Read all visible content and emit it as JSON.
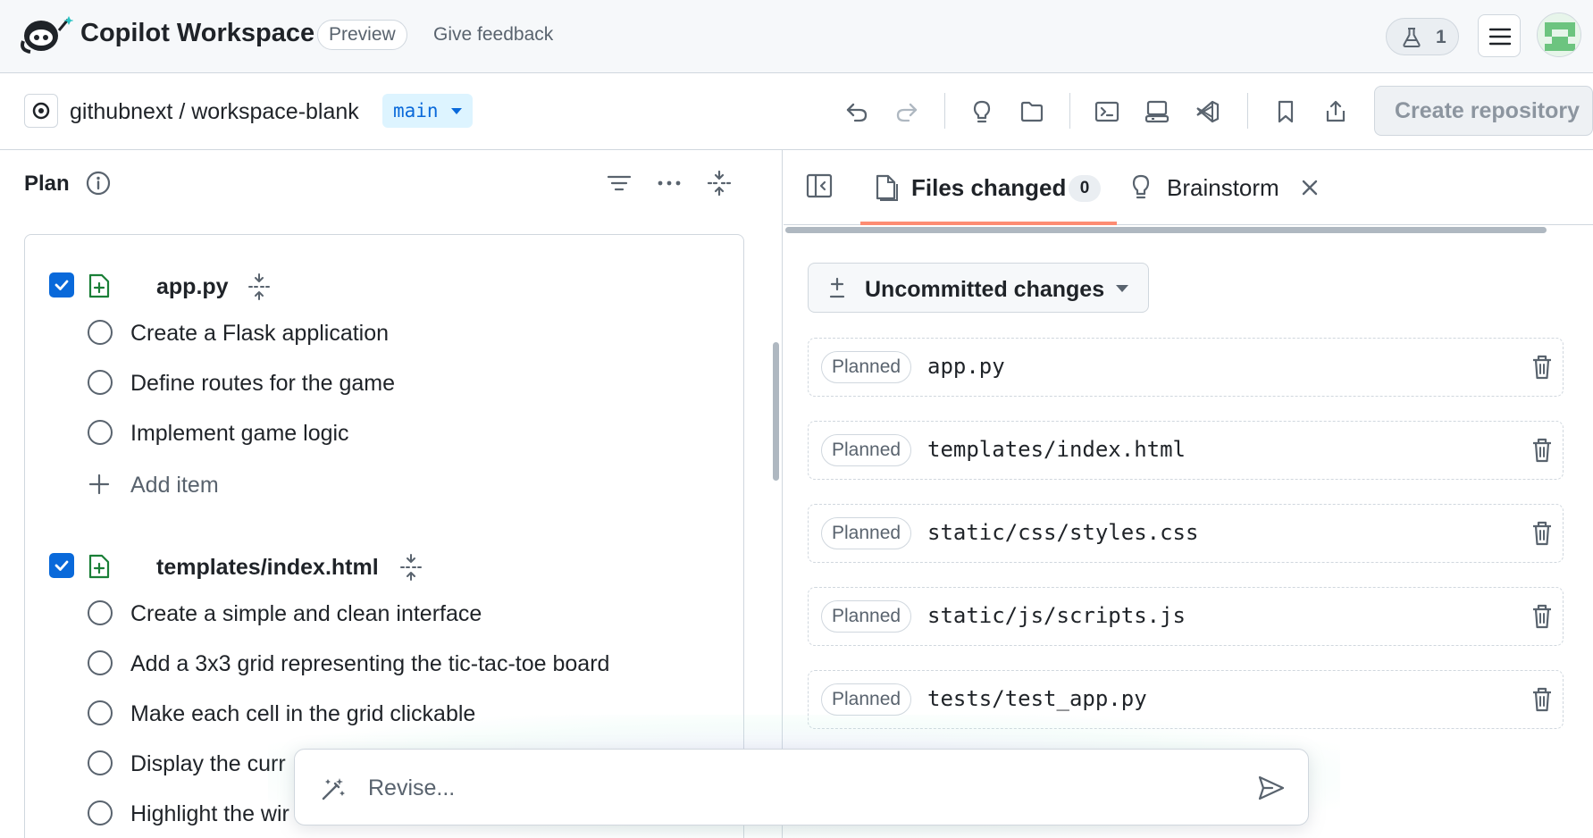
{
  "header": {
    "app_title": "Copilot Workspace",
    "preview_badge": "Preview",
    "feedback_link": "Give feedback",
    "labs_count": "1"
  },
  "repo": {
    "path": "githubnext / workspace-blank",
    "branch": "main",
    "create_button": "Create repository"
  },
  "plan": {
    "title": "Plan",
    "files": [
      {
        "name": "app.py",
        "checked": true,
        "tasks": [
          "Create a Flask application",
          "Define routes for the game",
          "Implement game logic"
        ],
        "add_item_label": "Add item"
      },
      {
        "name": "templates/index.html",
        "checked": true,
        "tasks": [
          "Create a simple and clean interface",
          "Add a 3x3 grid representing the tic-tac-toe board",
          "Make each cell in the grid clickable",
          "Display the curr",
          "Highlight the wir"
        ]
      }
    ]
  },
  "right_panel": {
    "tabs": [
      {
        "label": "Files changed",
        "count": "0",
        "active": true
      },
      {
        "label": "Brainstorm",
        "active": false
      }
    ],
    "changes_dropdown": "Uncommitted changes",
    "changes": [
      {
        "status": "Planned",
        "path": "app.py"
      },
      {
        "status": "Planned",
        "path": "templates/index.html"
      },
      {
        "status": "Planned",
        "path": "static/css/styles.css"
      },
      {
        "status": "Planned",
        "path": "static/js/scripts.js"
      },
      {
        "status": "Planned",
        "path": "tests/test_app.py"
      }
    ]
  },
  "revise": {
    "placeholder": "Revise..."
  },
  "colors": {
    "accent": "#0969da",
    "tab_underline": "#fd8c73",
    "file_add_green": "#1a7f37",
    "muted": "#59636e",
    "border": "#d0d7de"
  }
}
